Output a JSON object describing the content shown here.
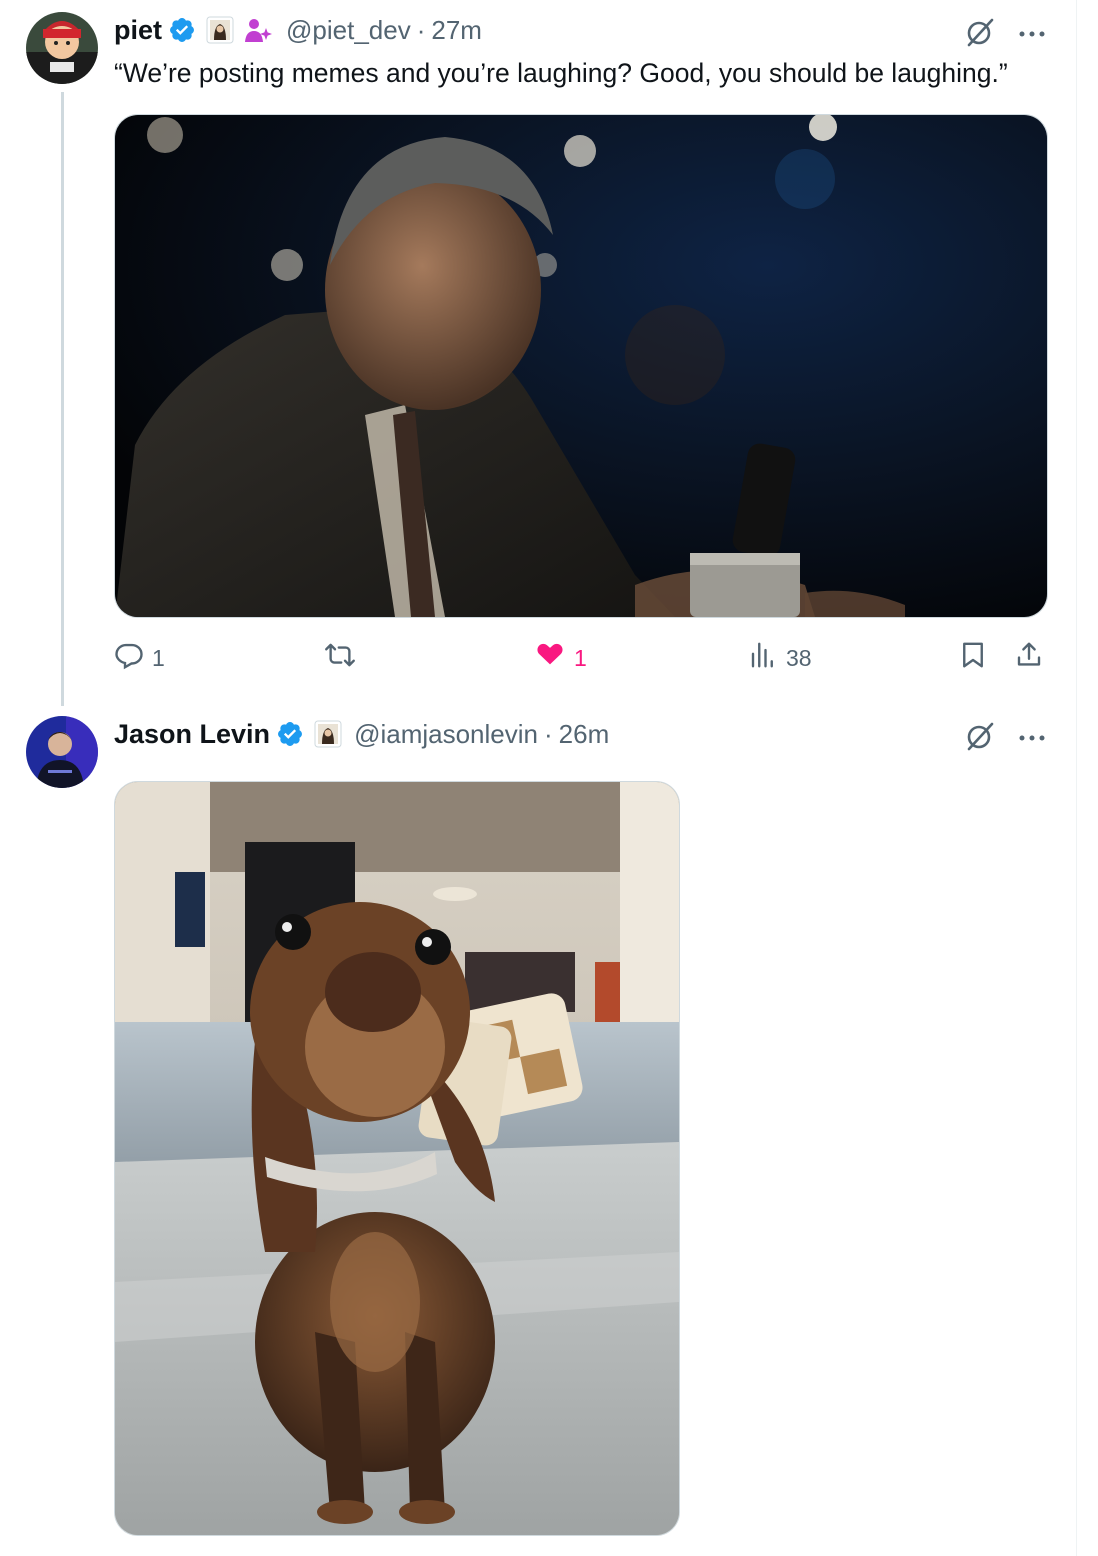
{
  "colors": {
    "text": "#0f1419",
    "secondary": "#536471",
    "verified": "#1d9bf0",
    "like": "#f91880",
    "divider": "#cfd9de"
  },
  "posts": [
    {
      "name": "piet",
      "handle": "@piet_dev",
      "dot": "·",
      "time": "27m",
      "text": "“We’re posting memes and you’re laughing? Good, you should be laughing.”",
      "actions": {
        "replies": "1",
        "reposts": "",
        "likes": "1",
        "views": "38"
      },
      "icons": [
        "verified-badge-icon",
        "affiliate-badge-icon",
        "sparkle-person-icon",
        "grok-icon",
        "more-icon",
        "reply-icon",
        "repost-icon",
        "heart-filled-icon",
        "views-icon",
        "bookmark-icon",
        "share-icon"
      ]
    },
    {
      "name": "Jason Levin",
      "handle": "@iamjasonlevin",
      "dot": "·",
      "time": "26m",
      "icons": [
        "verified-badge-icon",
        "affiliate-badge-icon",
        "grok-icon",
        "more-icon"
      ]
    }
  ]
}
